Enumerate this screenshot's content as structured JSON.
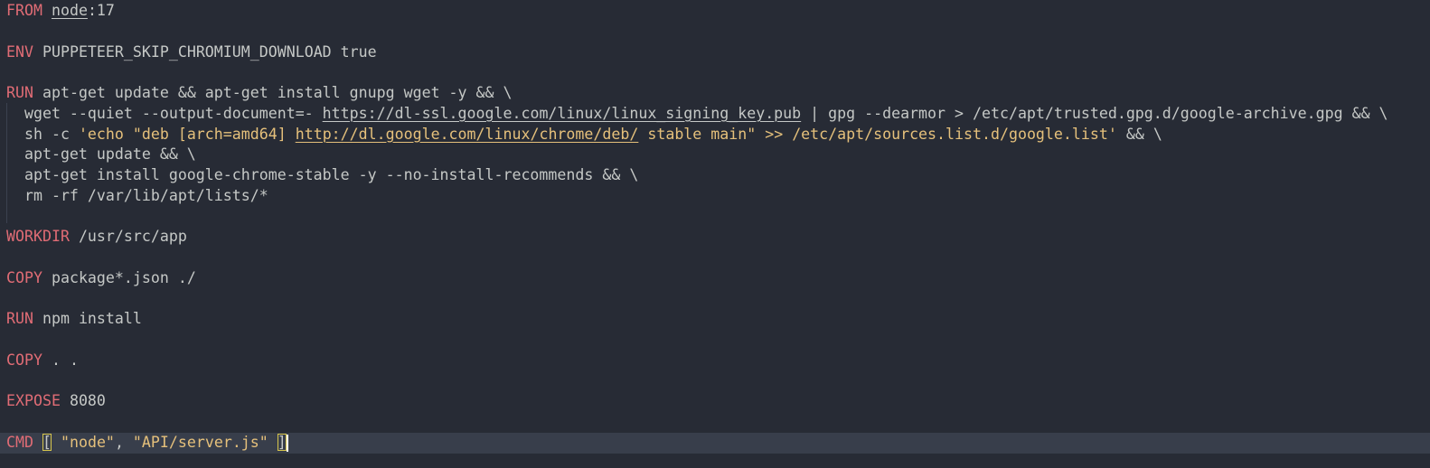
{
  "editor": {
    "language": "Dockerfile",
    "lines": {
      "l1": {
        "kw": "FROM",
        "image": "node",
        "tag": ":17"
      },
      "l3": {
        "kw": "ENV",
        "rest": "PUPPETEER_SKIP_CHROMIUM_DOWNLOAD true"
      },
      "l5": {
        "kw": "RUN",
        "rest": "apt-get update && apt-get install gnupg wget -y && \\"
      },
      "l6": {
        "pre": "  wget --quiet --output-document=- ",
        "url": "https://dl-ssl.google.com/linux/linux_signing_key.pub",
        "post": " | gpg --dearmor > /etc/apt/trusted.gpg.d/google-archive.gpg && \\"
      },
      "l7": {
        "pre": "  sh -c ",
        "str1": "'echo \"deb [arch=amd64] ",
        "url": "http://dl.google.com/linux/chrome/deb/",
        "str2": " stable main\" >> /etc/apt/sources.list.d/google.list'",
        "post": " && \\"
      },
      "l8": {
        "text": "  apt-get update && \\"
      },
      "l9": {
        "text": "  apt-get install google-chrome-stable -y --no-install-recommends && \\"
      },
      "l10": {
        "text": "  rm -rf /var/lib/apt/lists/*"
      },
      "l12": {
        "kw": "WORKDIR",
        "rest": "/usr/src/app"
      },
      "l14": {
        "kw": "COPY",
        "rest": "package*.json ./"
      },
      "l16": {
        "kw": "RUN",
        "rest": "npm install"
      },
      "l18": {
        "kw": "COPY",
        "rest": ". ."
      },
      "l20": {
        "kw": "EXPOSE",
        "rest": "8080"
      },
      "l22": {
        "kw": "CMD",
        "open": "[",
        "arg1": "\"node\"",
        "sep": ", ",
        "arg2": "\"API/server.js\"",
        "close": "]"
      }
    }
  },
  "colors": {
    "background": "#272b35",
    "keyword": "#e06c75",
    "string": "#e5c07b",
    "text": "#c5c8c6",
    "current_line": "#383e4b",
    "bracket_match": "#d8c74d"
  }
}
